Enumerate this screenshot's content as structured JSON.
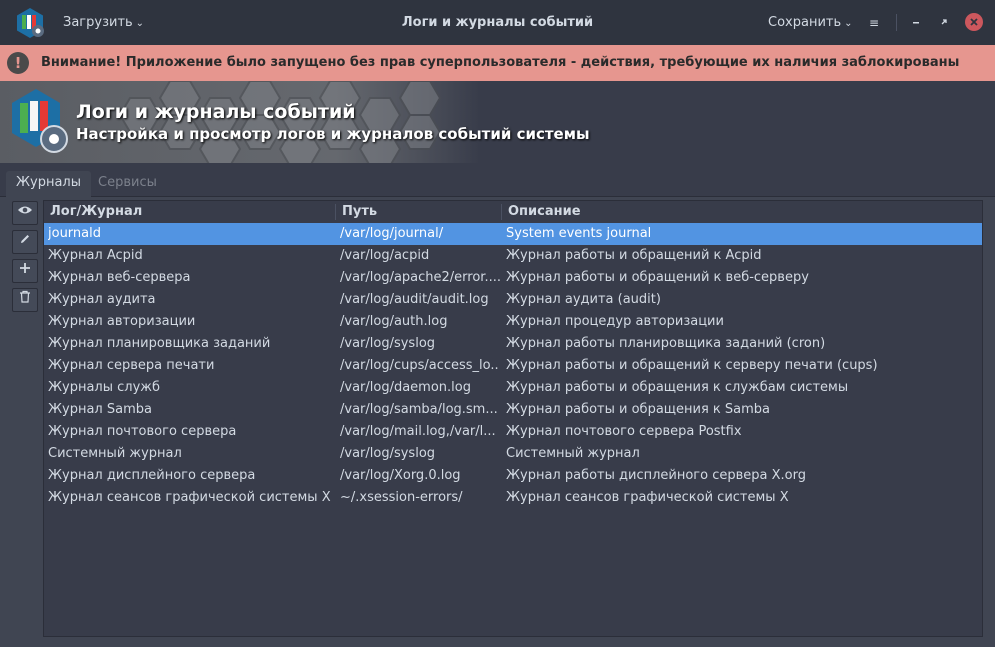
{
  "titlebar": {
    "load_label": "Загрузить",
    "title": "Логи и журналы событий",
    "save_label": "Сохранить"
  },
  "banner": {
    "icon": "!",
    "text": "Внимание! Приложение было запущено без прав суперпользователя - действия, требующие их наличия заблокированы"
  },
  "header": {
    "title": "Логи и журналы событий",
    "subtitle": "Настройка и просмотр логов и журналов событий системы"
  },
  "tabs": [
    {
      "label": "Журналы",
      "active": true
    },
    {
      "label": "Сервисы",
      "active": false
    }
  ],
  "table": {
    "columns": [
      "Лог/Журнал",
      "Путь",
      "Описание"
    ],
    "rows": [
      [
        "journald",
        "/var/log/journal/",
        "System events journal"
      ],
      [
        "Журнал Acpid",
        "/var/log/acpid",
        "Журнал работы и обращений к Acpid"
      ],
      [
        "Журнал веб-сервера",
        "/var/log/apache2/error....",
        "Журнал работы и обращений к веб-серверу"
      ],
      [
        "Журнал аудита",
        "/var/log/audit/audit.log",
        "Журнал аудита (audit)"
      ],
      [
        "Журнал авторизации",
        "/var/log/auth.log",
        "Журнал процедур авторизации"
      ],
      [
        "Журнал планировщика заданий",
        "/var/log/syslog",
        "Журнал работы планировщика заданий (cron)"
      ],
      [
        "Журнал сервера печати",
        "/var/log/cups/access_lo...",
        "Журнал работы и обращений к серверу печати (cups)"
      ],
      [
        "Журналы служб",
        "/var/log/daemon.log",
        "Журнал работы и обращения к службам системы"
      ],
      [
        "Журнал Samba",
        "/var/log/samba/log.sm...",
        "Журнал работы и обращения к Samba"
      ],
      [
        "Журнал почтового сервера",
        "/var/log/mail.log,/var/l...",
        "Журнал почтового сервера Postfix"
      ],
      [
        "Системный журнал",
        "/var/log/syslog",
        "Системный журнал"
      ],
      [
        "Журнал дисплейного сервера",
        "/var/log/Xorg.0.log",
        "Журнал работы дисплейного сервера X.org"
      ],
      [
        "Журнал сеансов графической системы X",
        "~/.xsession-errors/",
        "Журнал сеансов графической системы X"
      ]
    ],
    "selected_row": 0
  },
  "colors": {
    "accent": "#5294e2",
    "banner": "#e6968f",
    "close": "#cc575d"
  }
}
